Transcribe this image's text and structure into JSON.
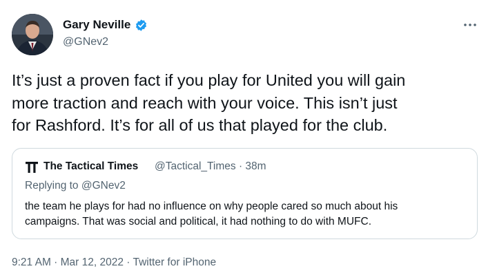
{
  "author": {
    "display_name": "Gary Neville",
    "handle": "@GNev2",
    "verified": true,
    "verified_color": "#1d9bf0"
  },
  "tweet": {
    "text_lines": [
      "It’s just a proven fact if you play for United you will gain",
      "more traction and reach with your voice. This isn’t just",
      "for Rashford. It’s for all of us that played for the club."
    ]
  },
  "quoted_tweet": {
    "author_name": "The Tactical Times",
    "meta": "@Tactical_Times · 38m",
    "replying_prefix": "Replying to ",
    "replying_to": "@GNev2",
    "text_lines": [
      "the team he plays for had no influence on why people cared so much about his",
      "campaigns. That was social and political, it had nothing to do with MUFC."
    ]
  },
  "footer": {
    "timestamp": "9:21 AM · Mar 12, 2022 · Twitter for iPhone"
  },
  "icons": {
    "verified": "verified-badge-icon",
    "more": "more-options-icon",
    "quote_logo": "tactical-times-logo-icon"
  }
}
